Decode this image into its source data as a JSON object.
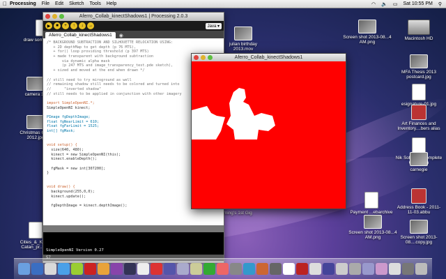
{
  "menubar": {
    "app": "Processing",
    "items": [
      "File",
      "Edit",
      "Sketch",
      "Tools",
      "Help"
    ],
    "clock": "Sat 10:55 PM"
  },
  "processing_window": {
    "title": "Aferro_Collab_kinectShadows1 | Processing 2.0.3",
    "mode": "Java ▾",
    "tab": "Aferro_Collab_kinectShadows1",
    "code": [
      {
        "cls": "c",
        "text": "/* BACKGROUND SUBTRACTION AND SILHOUETTE RELOCATION USING:"
      },
      {
        "cls": "c",
        "text": "   + 2D depthMap to get depth (p 76 MTS),"
      },
      {
        "cls": "c",
        "text": "   + for() loop providing threshold (p 397 MTS)"
      },
      {
        "cls": "c",
        "text": "   + made transparent with background subtraction"
      },
      {
        "cls": "c",
        "text": "       via dynamic alpha mask"
      },
      {
        "cls": "c",
        "text": "       (p 247 MTS and image_transparency_test.pde sketch),"
      },
      {
        "cls": "c",
        "text": "   + sized and moved at the end when drawn */"
      },
      {
        "cls": "",
        "text": ""
      },
      {
        "cls": "c",
        "text": "// still need to try miroground as well"
      },
      {
        "cls": "c",
        "text": "// remaining shadow still needs to be colored and turned into"
      },
      {
        "cls": "c",
        "text": "//      \"inverted shadow\""
      },
      {
        "cls": "c",
        "text": "// still needs to be applied in conjunction with other imagery"
      },
      {
        "cls": "",
        "text": ""
      },
      {
        "cls": "k",
        "text": "import SimpleOpenNI.*;"
      },
      {
        "cls": "",
        "text": "SimpleOpenNI kinect;"
      },
      {
        "cls": "",
        "text": ""
      },
      {
        "cls": "t",
        "text": "PImage fgDepthImage;"
      },
      {
        "cls": "t",
        "text": "float fgNearLimit = 610;"
      },
      {
        "cls": "t",
        "text": "float fgFarLimit = 1525;"
      },
      {
        "cls": "t",
        "text": "int[] fgMask;"
      },
      {
        "cls": "",
        "text": ""
      },
      {
        "cls": "",
        "text": ""
      },
      {
        "cls": "k",
        "text": "void setup() {"
      },
      {
        "cls": "",
        "text": "  size(640, 480);"
      },
      {
        "cls": "",
        "text": "  kinect = new SimpleOpenNI(this);"
      },
      {
        "cls": "",
        "text": "  kinect.enableDepth();"
      },
      {
        "cls": "",
        "text": ""
      },
      {
        "cls": "",
        "text": "  fgMask = new int[307200];"
      },
      {
        "cls": "",
        "text": "}"
      },
      {
        "cls": "",
        "text": ""
      },
      {
        "cls": "",
        "text": ""
      },
      {
        "cls": "k",
        "text": "void draw() {"
      },
      {
        "cls": "",
        "text": "  background(255,0,0);"
      },
      {
        "cls": "",
        "text": "  kinect.update();"
      },
      {
        "cls": "",
        "text": ""
      },
      {
        "cls": "",
        "text": "  fgDepthImage = kinect.depthImage();"
      }
    ],
    "console_output": "SimpleOpenNI Version 0.27",
    "line_number": "57"
  },
  "sketch_window": {
    "title": "Aferro_Collab_kinectShadows1",
    "bg_color": "#ff0000"
  },
  "desktop": {
    "right_icons": [
      {
        "label": "Macintosh HD",
        "kind": "hd"
      },
      {
        "label": "MFA Thesis 2013 postcard.jpg",
        "kind": "photo"
      },
      {
        "label": "esignature-01.jpg",
        "kind": "file"
      },
      {
        "label": "Art Finances and Inventory....bers alias",
        "kind": "book"
      },
      {
        "label": "Nik Software Complete Collection",
        "kind": "file"
      },
      {
        "label": "carnegie",
        "kind": "photo"
      },
      {
        "label": "Address Book - 2011-11-03.abbu",
        "kind": "book"
      },
      {
        "label": "Screen shot 2013-08....copy.jpg",
        "kind": "photo"
      }
    ],
    "screen_shot_top": "Screen shot 2013-08...4 AM.png",
    "screen_shot_mid": "Screen shot 2013-08...4 AM.png",
    "payment": "Payment ...ebarchive",
    "julian": "julian birthday 2013.mov",
    "lemming": "Lemming's 1st Gig",
    "left_icons": [
      {
        "label": "draw some images",
        "kind": "file"
      },
      {
        "label": "camera 10",
        "kind": "photo"
      },
      {
        "label": "Christmas Card 2012.jpg",
        "kind": "photo"
      },
      {
        "label": "Cities_&_Knigh Catan_pr...aur",
        "kind": "file"
      }
    ]
  }
}
